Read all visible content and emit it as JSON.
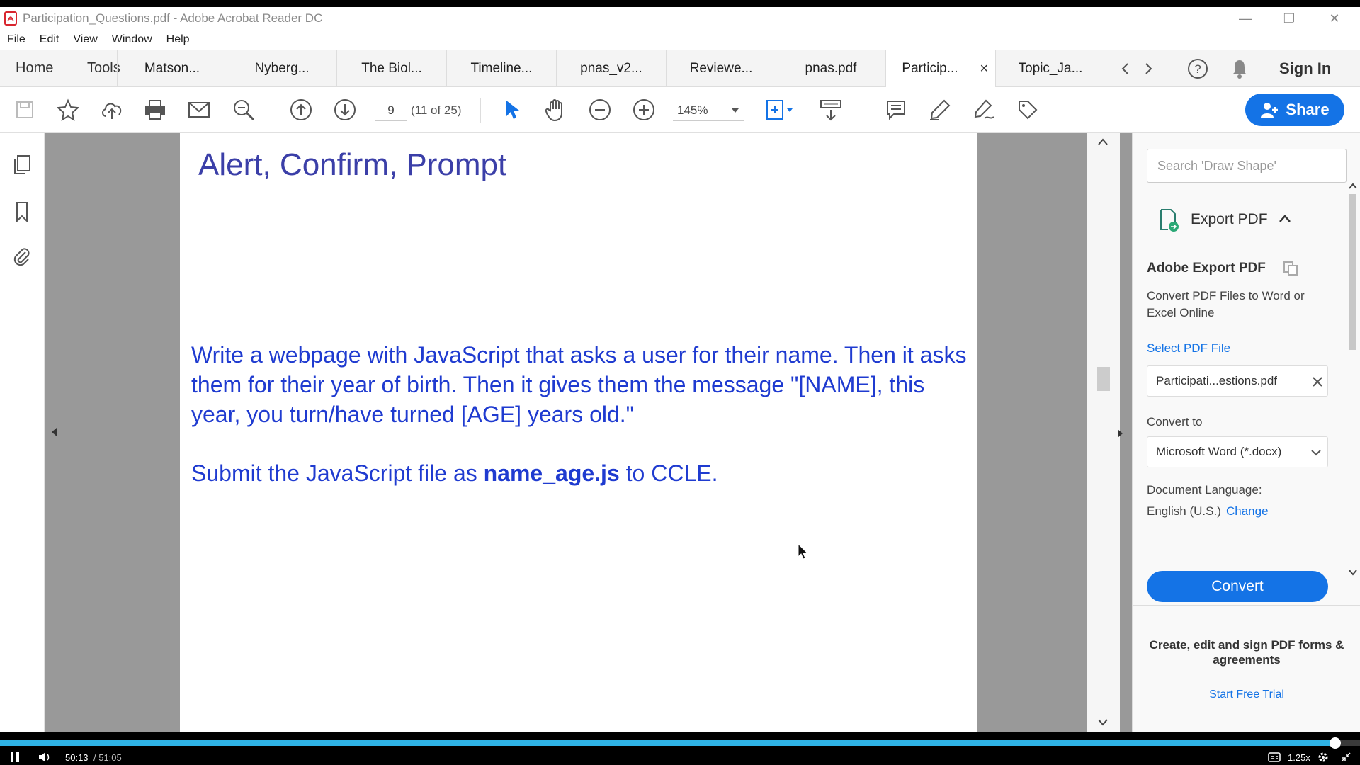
{
  "window": {
    "title": "Participation_Questions.pdf - Adobe Acrobat Reader DC",
    "minimize": "—",
    "restore": "❐",
    "close": "✕"
  },
  "menu": [
    "File",
    "Edit",
    "View",
    "Window",
    "Help"
  ],
  "nav_tabs": {
    "home": "Home",
    "tools": "Tools"
  },
  "doc_tabs": [
    "Matson...",
    "Nyberg...",
    "The Biol...",
    "Timeline...",
    "pnas_v2...",
    "Reviewe...",
    "pnas.pdf",
    "Particip...",
    "Topic_Ja..."
  ],
  "active_tab_index": 7,
  "tab_close": "×",
  "sign_in": "Sign In",
  "toolbar": {
    "page_number": "9",
    "page_count": "(11 of 25)",
    "zoom": "145%",
    "share": "Share"
  },
  "pdf": {
    "title": "Alert, Confirm, Prompt",
    "body": "Write a webpage with JavaScript that asks a user for their name. Then it asks them for their year of birth. Then it gives them the message \"[NAME], this year, you turn/have turned [AGE] years old.\"",
    "submit_prefix": "Submit the JavaScript file as ",
    "submit_filename": "name_age.js",
    "submit_suffix": " to CCLE."
  },
  "right_panel": {
    "search_placeholder": "Search 'Draw Shape'",
    "export_label": "Export PDF",
    "heading": "Adobe Export PDF",
    "description": "Convert PDF Files to Word or Excel Online",
    "select_file": "Select PDF File",
    "file_name": "Participati...estions.pdf",
    "convert_to_label": "Convert to",
    "convert_to_value": "Microsoft Word (*.docx)",
    "doc_language_label": "Document Language:",
    "doc_language_value": "English (U.S.)",
    "change": "Change",
    "convert_button": "Convert",
    "promo": "Create, edit and sign PDF forms & agreements",
    "trial": "Start Free Trial"
  },
  "video": {
    "current_time": "50:13",
    "total_time": "/ 51:05",
    "speed": "1.25x",
    "progress": 0.982
  },
  "colors": {
    "accent": "#1473e6",
    "pdf_text": "#1f3bd0",
    "pdf_title": "#3b3fa8",
    "progress": "#2fb3e6"
  }
}
